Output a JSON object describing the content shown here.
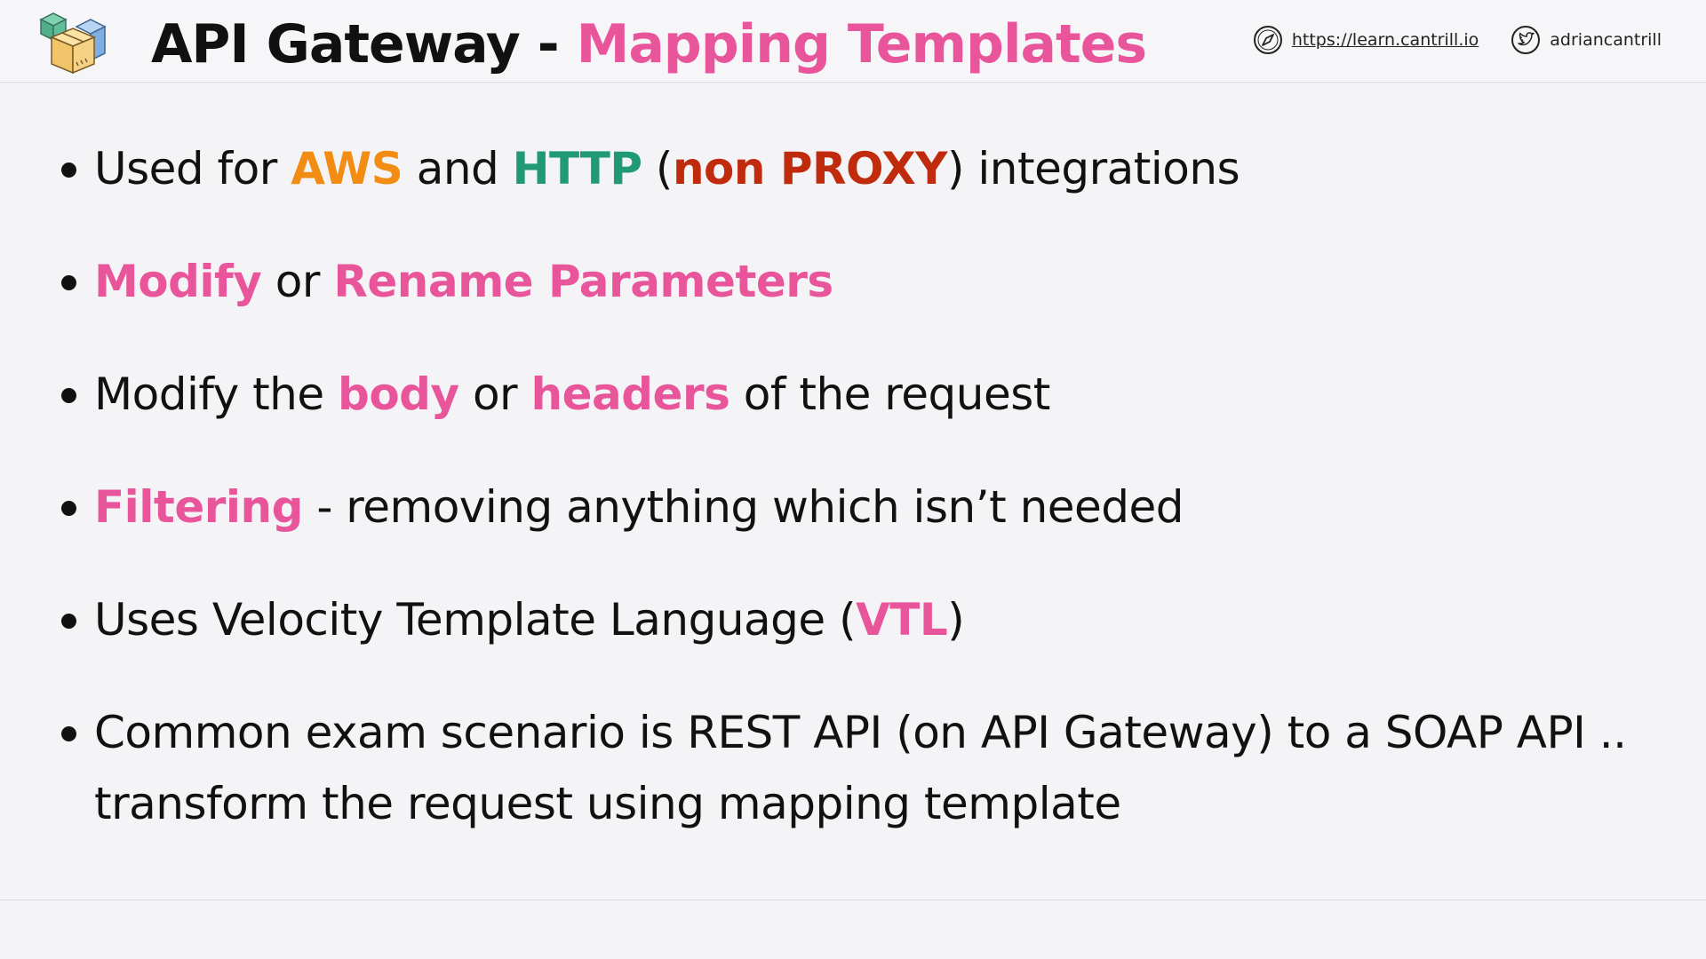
{
  "header": {
    "title_main": "API Gateway - ",
    "title_accent": "Mapping Templates",
    "website": "https://learn.cantrill.io",
    "twitter": "adriancantrill",
    "logo_icon": "stacked-cubes-icon",
    "website_icon": "compass-icon",
    "twitter_icon": "twitter-bird-icon"
  },
  "bullets": [
    {
      "segments": [
        {
          "text": "Used for "
        },
        {
          "text": "AWS",
          "style": "orange"
        },
        {
          "text": " and "
        },
        {
          "text": "HTTP",
          "style": "green"
        },
        {
          "text": " ("
        },
        {
          "text": "non PROXY",
          "style": "red"
        },
        {
          "text": ") integrations"
        }
      ]
    },
    {
      "segments": [
        {
          "text": "Modify",
          "style": "pink"
        },
        {
          "text": " or "
        },
        {
          "text": "Rename Parameters",
          "style": "pink"
        }
      ]
    },
    {
      "segments": [
        {
          "text": "Modify the "
        },
        {
          "text": "body",
          "style": "pink"
        },
        {
          "text": " or "
        },
        {
          "text": "headers",
          "style": "pink"
        },
        {
          "text": " of the request"
        }
      ]
    },
    {
      "segments": [
        {
          "text": "Filtering",
          "style": "pink"
        },
        {
          "text": " - removing anything which isn’t needed"
        }
      ]
    },
    {
      "segments": [
        {
          "text": "Uses Velocity Template Language ("
        },
        {
          "text": "VTL",
          "style": "pink"
        },
        {
          "text": ")"
        }
      ]
    },
    {
      "segments": [
        {
          "text": "Common exam scenario is REST API (on API Gateway) to a SOAP API .. transform the request using mapping template"
        }
      ]
    }
  ],
  "colors": {
    "accent_pink": "#e8559b",
    "aws_orange": "#f28c12",
    "http_green": "#1f9a72",
    "proxy_red": "#c02a0d",
    "text": "#111111",
    "background": "#f4f4f7"
  }
}
